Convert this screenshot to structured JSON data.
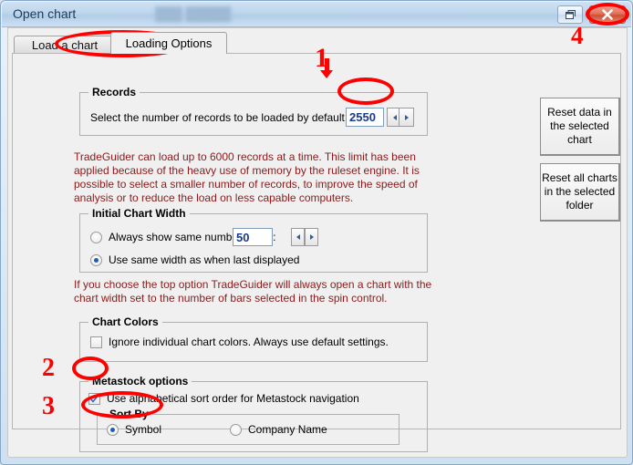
{
  "window": {
    "title": "Open chart",
    "ghost_title": "███ █████",
    "restore_icon": "restore-window-icon",
    "close_icon": "close-icon"
  },
  "tabs": [
    {
      "label": "Load a chart",
      "active": false
    },
    {
      "label": "Loading Options",
      "active": true
    }
  ],
  "records": {
    "group_title": "Records",
    "label": "Select the number of records to be loaded by default .........",
    "value": "2550",
    "spin_prev_icon": "caret-left-icon",
    "spin_next_icon": "caret-right-icon"
  },
  "note_records": "TradeGuider can load up to 6000 records at a time. This limit has been applied because of the heavy use of memory by the ruleset engine. It is possible to select a smaller number of records, to improve the speed of analysis or to reduce the load on less capable computers.",
  "chart_width": {
    "group_title": "Initial Chart Width",
    "option_bars_label": "Always show same number of bar:",
    "option_bars_selected": false,
    "bars_value": "50",
    "option_last_label": "Use same width as when last displayed",
    "option_last_selected": true,
    "spin_prev_icon": "caret-left-icon",
    "spin_next_icon": "caret-right-icon"
  },
  "note_width": "If you choose the top option TradeGuider will always open a chart with the chart width set to the  number of bars selected in the spin control.",
  "chart_colors": {
    "group_title": "Chart Colors",
    "checkbox_label": "Ignore individual chart colors. Always use default settings.",
    "checked": false
  },
  "metastock": {
    "group_title": "Metastock options",
    "checkbox_label": "Use alphabetical sort order for Metastock navigation",
    "checked": true,
    "sort_by": {
      "group_title": "Sort By",
      "options": [
        {
          "label": "Symbol",
          "selected": true
        },
        {
          "label": "Company Name",
          "selected": false
        }
      ]
    }
  },
  "side_buttons": [
    {
      "label": "Reset data in the selected chart"
    },
    {
      "label": "Reset all charts in the selected folder"
    }
  ],
  "annotations": {
    "marks": [
      "1",
      "2",
      "3",
      "4"
    ],
    "color": "#ff0000"
  }
}
